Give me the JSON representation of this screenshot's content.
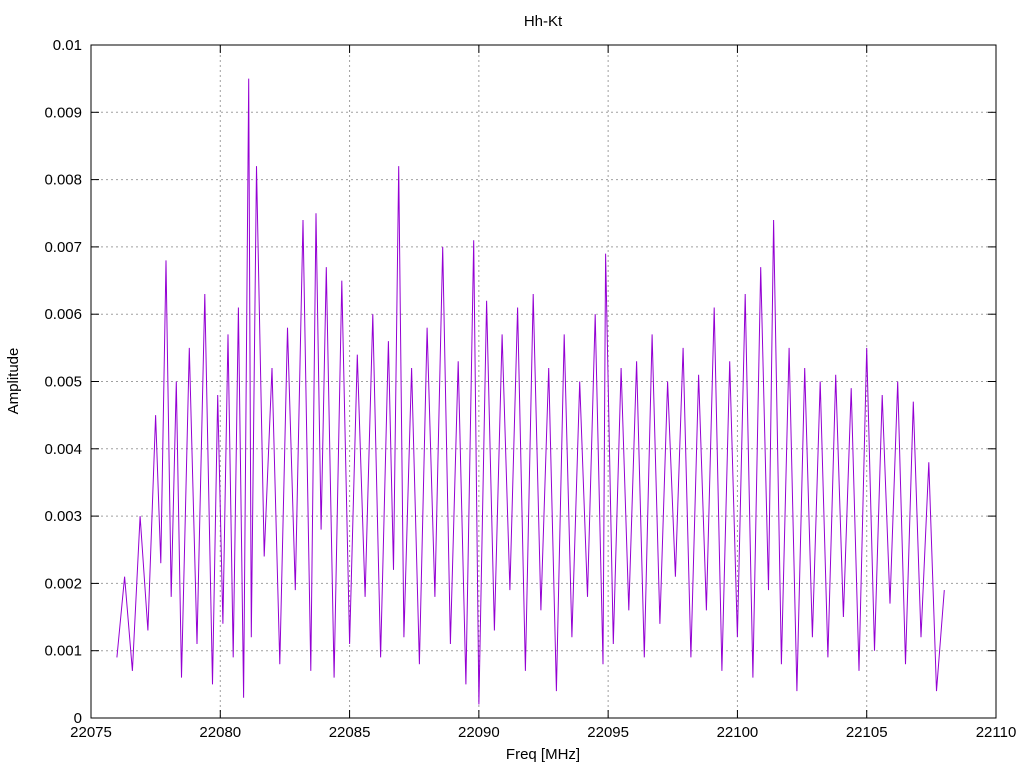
{
  "chart_data": {
    "type": "line",
    "title": "Hh-Kt",
    "xlabel": "Freq [MHz]",
    "ylabel": "Amplitude",
    "xlim": [
      22075,
      22110
    ],
    "ylim": [
      0,
      0.01
    ],
    "x_ticks": [
      22075,
      22080,
      22085,
      22090,
      22095,
      22100,
      22105,
      22110
    ],
    "x_tick_labels": [
      "22075",
      "22080",
      "22085",
      "22090",
      "22095",
      "22100",
      "22105",
      "22110"
    ],
    "y_ticks": [
      0,
      0.001,
      0.002,
      0.003,
      0.004,
      0.005,
      0.006,
      0.007,
      0.008,
      0.009,
      0.01
    ],
    "y_tick_labels": [
      "0",
      "0.001",
      "0.002",
      "0.003",
      "0.004",
      "0.005",
      "0.006",
      "0.007",
      "0.008",
      "0.009",
      "0.01"
    ],
    "grid": true,
    "legend": "none",
    "series": [
      {
        "color": "#9400d3",
        "x": [
          22076.0,
          22076.3,
          22076.6,
          22076.9,
          22077.2,
          22077.5,
          22077.7,
          22077.9,
          22078.1,
          22078.3,
          22078.5,
          22078.8,
          22079.1,
          22079.4,
          22079.7,
          22079.9,
          22080.1,
          22080.3,
          22080.5,
          22080.7,
          22080.9,
          22081.1,
          22081.2,
          22081.4,
          22081.7,
          22082.0,
          22082.3,
          22082.6,
          22082.9,
          22083.2,
          22083.5,
          22083.7,
          22083.9,
          22084.1,
          22084.4,
          22084.7,
          22085.0,
          22085.3,
          22085.6,
          22085.9,
          22086.2,
          22086.5,
          22086.7,
          22086.9,
          22087.1,
          22087.4,
          22087.7,
          22088.0,
          22088.3,
          22088.6,
          22088.9,
          22089.2,
          22089.5,
          22089.8,
          22090.0,
          22090.3,
          22090.6,
          22090.9,
          22091.2,
          22091.5,
          22091.8,
          22092.1,
          22092.4,
          22092.7,
          22093.0,
          22093.3,
          22093.6,
          22093.9,
          22094.2,
          22094.5,
          22094.8,
          22094.9,
          22095.2,
          22095.5,
          22095.8,
          22096.1,
          22096.4,
          22096.7,
          22097.0,
          22097.3,
          22097.6,
          22097.9,
          22098.2,
          22098.5,
          22098.8,
          22099.1,
          22099.4,
          22099.7,
          22100.0,
          22100.3,
          22100.6,
          22100.9,
          22101.2,
          22101.4,
          22101.7,
          22102.0,
          22102.3,
          22102.6,
          22102.9,
          22103.2,
          22103.5,
          22103.8,
          22104.1,
          22104.4,
          22104.7,
          22105.0,
          22105.3,
          22105.6,
          22105.9,
          22106.2,
          22106.5,
          22106.8,
          22107.1,
          22107.4,
          22107.7,
          22108.0
        ],
        "y": [
          0.0009,
          0.0021,
          0.0007,
          0.003,
          0.0013,
          0.0045,
          0.0023,
          0.0068,
          0.0018,
          0.005,
          0.0006,
          0.0055,
          0.0011,
          0.0063,
          0.0005,
          0.0048,
          0.0014,
          0.0057,
          0.0009,
          0.0061,
          0.0003,
          0.0095,
          0.0012,
          0.0082,
          0.0024,
          0.0052,
          0.0008,
          0.0058,
          0.0019,
          0.0074,
          0.0007,
          0.0075,
          0.0028,
          0.0067,
          0.0006,
          0.0065,
          0.0011,
          0.0054,
          0.0018,
          0.006,
          0.0009,
          0.0056,
          0.0022,
          0.0082,
          0.0012,
          0.0052,
          0.0008,
          0.0058,
          0.0018,
          0.007,
          0.0011,
          0.0053,
          0.0005,
          0.0071,
          0.0002,
          0.0062,
          0.0013,
          0.0057,
          0.0019,
          0.0061,
          0.0007,
          0.0063,
          0.0016,
          0.0052,
          0.0004,
          0.0057,
          0.0012,
          0.005,
          0.0018,
          0.006,
          0.0008,
          0.0069,
          0.0011,
          0.0052,
          0.0016,
          0.0053,
          0.0009,
          0.0057,
          0.0014,
          0.005,
          0.0021,
          0.0055,
          0.0009,
          0.0051,
          0.0016,
          0.0061,
          0.0007,
          0.0053,
          0.0012,
          0.0063,
          0.0006,
          0.0067,
          0.0019,
          0.0074,
          0.0008,
          0.0055,
          0.0004,
          0.0052,
          0.0012,
          0.005,
          0.0009,
          0.0051,
          0.0015,
          0.0049,
          0.0007,
          0.0055,
          0.001,
          0.0048,
          0.0017,
          0.005,
          0.0008,
          0.0047,
          0.0012,
          0.0038,
          0.0004,
          0.0019
        ]
      }
    ]
  }
}
